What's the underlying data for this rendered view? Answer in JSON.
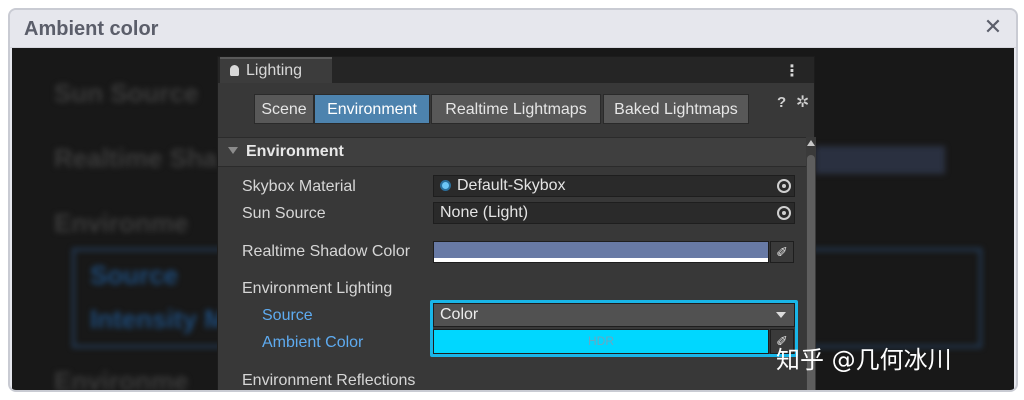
{
  "dialog": {
    "title": "Ambient color",
    "close_glyph": "✕"
  },
  "background_ghost": {
    "labels": [
      "Sun Source",
      "Realtime Sha",
      "Environme",
      "Source",
      "Intensity M",
      "Environme"
    ]
  },
  "window": {
    "tab_label": "Lighting",
    "menu_glyph": "⋮",
    "toolbar": {
      "tabs": [
        "Scene",
        "Environment",
        "Realtime Lightmaps",
        "Baked Lightmaps"
      ],
      "active_tab": "Environment",
      "help_glyph": "?",
      "settings_glyph": "✲"
    },
    "section": {
      "title": "Environment"
    },
    "fields": {
      "skybox_material": {
        "label": "Skybox Material",
        "value": "Default-Skybox"
      },
      "sun_source": {
        "label": "Sun Source",
        "value": "None (Light)"
      },
      "realtime_shadow_color": {
        "label": "Realtime Shadow Color",
        "color": "#687aa5"
      },
      "environment_lighting": {
        "label": "Environment Lighting"
      },
      "source": {
        "label": "Source",
        "value": "Color"
      },
      "ambient_color": {
        "label": "Ambient Color",
        "color": "#00d7ff",
        "badge": "HDR"
      },
      "environment_reflections": {
        "label": "Environment Reflections"
      }
    },
    "eyedropper_glyph": "✐"
  },
  "watermark": "知乎 @几何冰川",
  "colors": {
    "accent": "#4d83ae",
    "highlight": "#19b6e8",
    "ambient": "#00d7ff"
  }
}
